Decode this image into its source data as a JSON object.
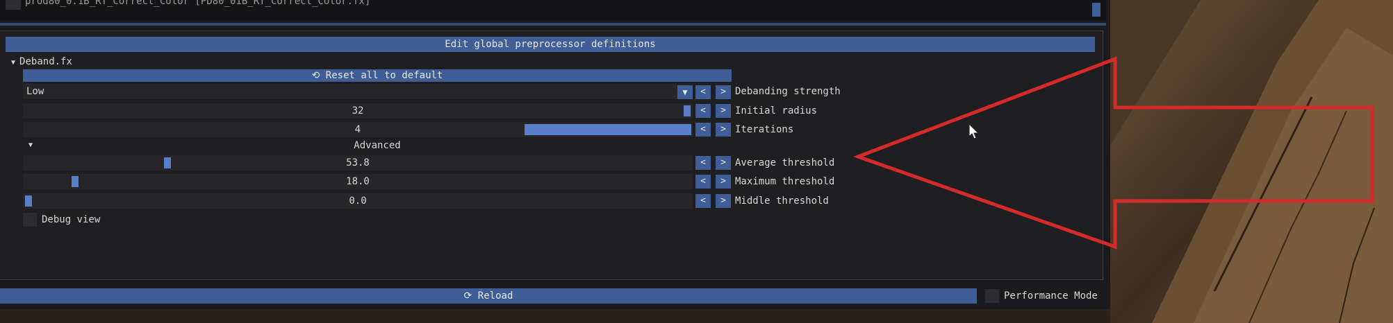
{
  "top": {
    "partial_text": "prod80_0.1B_RT_Correct_Color [PD80_01B_RT_Correct_Color.fx]"
  },
  "panel": {
    "header": "Edit global preprocessor definitions",
    "section": "Deband.fx",
    "reset_label": "Reset all to default",
    "rows": [
      {
        "kind": "combo",
        "value": "Low",
        "label": "Debanding strength"
      },
      {
        "kind": "slider",
        "value": "32",
        "label": "Initial radius",
        "fraction": 0.99
      },
      {
        "kind": "slider",
        "value": "4",
        "label": "Iterations",
        "fraction": 0.75
      },
      {
        "kind": "slider",
        "value": "53.8",
        "label": "Average threshold",
        "fraction": 0.215
      },
      {
        "kind": "slider",
        "value": "18.0",
        "label": "Maximum threshold",
        "fraction": 0.075
      },
      {
        "kind": "slider",
        "value": "0.0",
        "label": "Middle threshold",
        "fraction": 0.0
      }
    ],
    "advanced": "Advanced",
    "debug_view": "Debug view",
    "dec": "<",
    "inc": ">"
  },
  "footer": {
    "reload": "Reload",
    "performance_mode": "Performance Mode"
  },
  "colors": {
    "accent": "#3f5d96",
    "grab": "#5a7fc9",
    "annotation": "#d42a2a"
  },
  "icons": [
    "reset-icon",
    "reload-icon",
    "cursor-icon",
    "arrow-annotation"
  ]
}
